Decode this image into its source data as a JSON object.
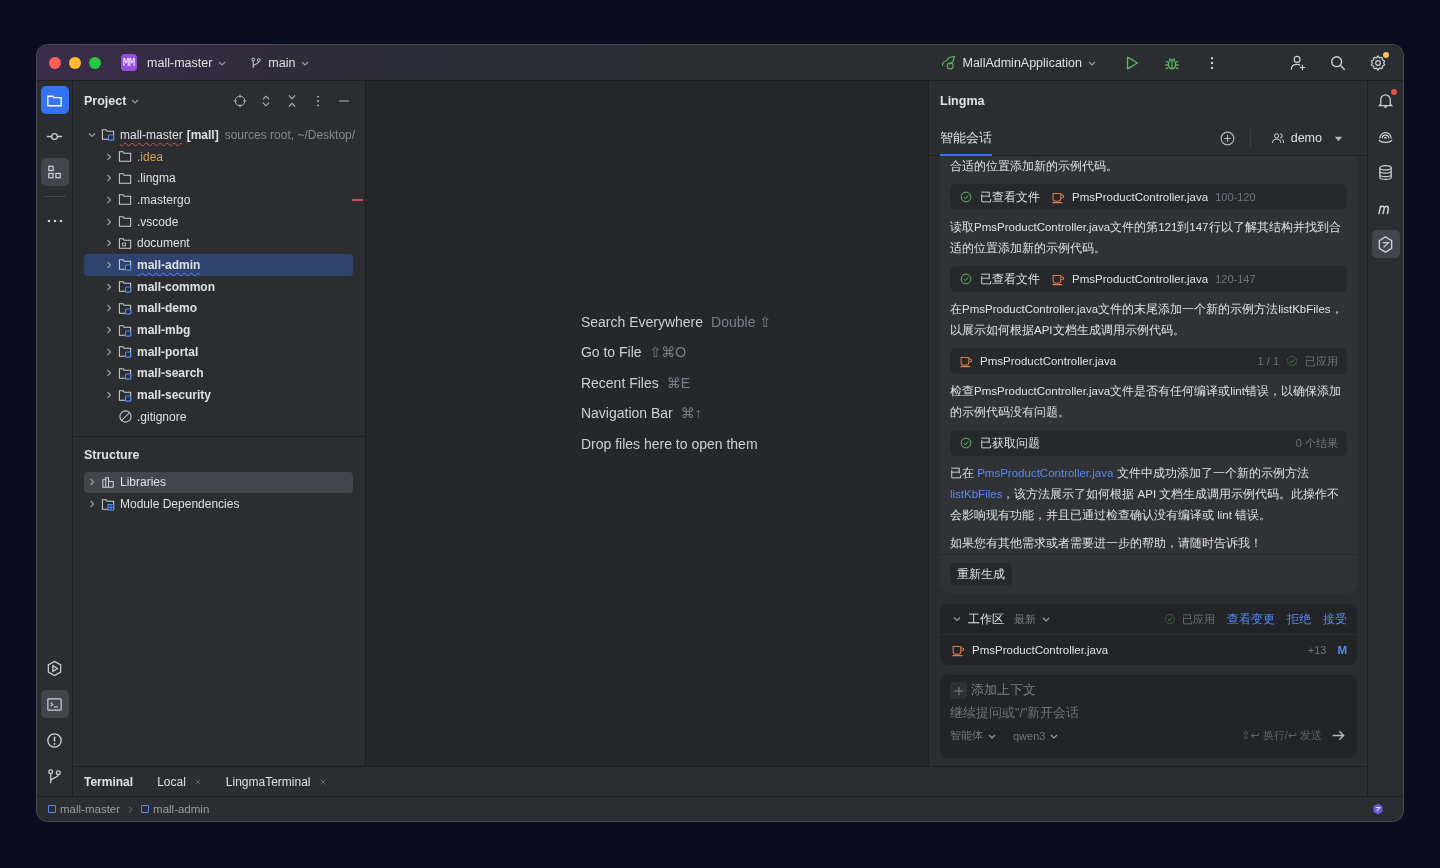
{
  "title_bar": {
    "project_badge": "MM",
    "project": "mall-master",
    "branch": "main",
    "run_config": "MallAdminApplication",
    "settings_badge": true
  },
  "left_toolbar": {
    "top": [
      {
        "selected": true,
        "focused": true
      },
      {
        "selected": false,
        "focused": false
      },
      {
        "selected": true,
        "focused": false
      },
      {
        "selected": false,
        "focused": false
      }
    ],
    "bottom": [
      {
        "selected": false,
        "focused": false
      },
      {
        "selected": true,
        "focused": false
      },
      {
        "selected": false,
        "focused": false
      },
      {
        "selected": false,
        "focused": false
      }
    ]
  },
  "project_panel": {
    "title": "Project",
    "root": {
      "name": "mall-master",
      "tag": "[mall]",
      "hint": "sources root, ~/Desktop/",
      "expanded": true,
      "children": [
        {
          "label": ".idea",
          "kind": "folder",
          "ignored": true,
          "flagged": false,
          "selected": false,
          "expanded": false
        },
        {
          "label": ".lingma",
          "kind": "folder",
          "ignored": false,
          "flagged": false,
          "selected": false,
          "expanded": false
        },
        {
          "label": ".mastergo",
          "kind": "folder",
          "ignored": false,
          "flagged": true,
          "selected": false,
          "expanded": false
        },
        {
          "label": ".vscode",
          "kind": "folder",
          "ignored": false,
          "flagged": false,
          "selected": false,
          "expanded": false
        },
        {
          "label": "document",
          "kind": "resources",
          "ignored": false,
          "flagged": false,
          "selected": false,
          "expanded": false
        },
        {
          "label": "mall-admin",
          "kind": "module",
          "ignored": false,
          "flagged": false,
          "selected": true,
          "expanded": false
        },
        {
          "label": "mall-common",
          "kind": "module",
          "ignored": false,
          "flagged": false,
          "selected": false,
          "expanded": false
        },
        {
          "label": "mall-demo",
          "kind": "module",
          "ignored": false,
          "flagged": false,
          "selected": false,
          "expanded": false
        },
        {
          "label": "mall-mbg",
          "kind": "module",
          "ignored": false,
          "flagged": false,
          "selected": false,
          "expanded": false
        },
        {
          "label": "mall-portal",
          "kind": "module",
          "ignored": false,
          "flagged": false,
          "selected": false,
          "expanded": false
        },
        {
          "label": "mall-search",
          "kind": "module",
          "ignored": false,
          "flagged": false,
          "selected": false,
          "expanded": false
        },
        {
          "label": "mall-security",
          "kind": "module",
          "ignored": false,
          "flagged": false,
          "selected": false,
          "expanded": false
        },
        {
          "label": ".gitignore",
          "kind": "file",
          "ignored": false,
          "flagged": false,
          "selected": false
        }
      ]
    }
  },
  "structure_panel": {
    "title": "Structure",
    "items": [
      {
        "label": "Libraries",
        "kind": "libraries",
        "selected": true,
        "expanded": false
      },
      {
        "label": "Module Dependencies",
        "kind": "dependencies",
        "selected": false,
        "expanded": false
      }
    ]
  },
  "editor_hints": [
    {
      "label": "Search Everywhere",
      "shortcut": "Double ⇧"
    },
    {
      "label": "Go to File",
      "shortcut": "⇧⌘O"
    },
    {
      "label": "Recent Files",
      "shortcut": "⌘E"
    },
    {
      "label": "Navigation Bar",
      "shortcut": "⌘↑"
    },
    {
      "label": "Drop files here to open them"
    }
  ],
  "lingma": {
    "title": "Lingma",
    "tab": {
      "label": "智能会话",
      "selected": true
    },
    "user": "demo",
    "messages": [
      {
        "kind": "text",
        "text": "合适的位置添加新的示例代码。"
      },
      {
        "kind": "tool",
        "done": true,
        "status": "已查看文件",
        "file": "PmsProductController.java",
        "range": "100-120"
      },
      {
        "kind": "text",
        "text": "读取PmsProductController.java文件的第121到147行以了解其结构并找到合适的位置添加新的示例代码。"
      },
      {
        "kind": "tool",
        "done": true,
        "status": "已查看文件",
        "file": "PmsProductController.java",
        "range": "120-147"
      },
      {
        "kind": "text",
        "text": "在PmsProductController.java文件的末尾添加一个新的示例方法listKbFiles，以展示如何根据API文档生成调用示例代码。"
      },
      {
        "kind": "edit",
        "file": "PmsProductController.java",
        "count": "1 / 1",
        "applied": true,
        "status": "已应用"
      },
      {
        "kind": "text",
        "text": "检查PmsProductController.java文件是否有任何编译或lint错误，以确保添加的示例代码没有问题。"
      },
      {
        "kind": "tool",
        "done": true,
        "status": "已获取问题",
        "result": "0 个结果"
      },
      {
        "kind": "rich",
        "parts": [
          {
            "text": "已在 ",
            "link": false
          },
          {
            "text": "PmsProductController.java",
            "link": true
          },
          {
            "text": " 文件中成功添加了一个新的示例方法 ",
            "link": false
          },
          {
            "text": "listKbFiles",
            "link": true
          },
          {
            "text": "，该方法展示了如何根据 API 文档生成调用示例代码。此操作不会影响现有功能，并且已通过检查确认没有编译或 lint 错误。",
            "link": false
          }
        ]
      },
      {
        "kind": "text",
        "text": "如果您有其他需求或者需要进一步的帮助，请随时告诉我！"
      }
    ],
    "regenerate": "重新生成",
    "workspace": {
      "title": "工作区",
      "expanded": true,
      "filter": "最新",
      "applied": true,
      "status": "已应用",
      "actions": [
        "查看变更",
        "拒绝",
        "接受"
      ],
      "files": [
        {
          "name": "PmsProductController.java",
          "added": "+13",
          "state": "M"
        }
      ]
    },
    "input": {
      "add_context": "添加上下文",
      "placeholder": "继续提问或\"/\"新开会话",
      "mode": "智能体",
      "model": "qwen3",
      "hint": "⇧↩ 换行/↩ 发送"
    }
  },
  "right_toolbar": [
    {
      "selected": false,
      "badge": true
    },
    {
      "selected": false,
      "badge": false
    },
    {
      "selected": false,
      "badge": false
    },
    {
      "selected": false,
      "badge": false
    },
    {
      "selected": true,
      "badge": false
    }
  ],
  "terminal": {
    "title": "Terminal",
    "tabs": [
      {
        "label": "Local"
      },
      {
        "label": "LingmaTerminal"
      }
    ]
  },
  "status_bar": {
    "breadcrumbs": [
      "mall-master",
      "mall-admin"
    ]
  }
}
